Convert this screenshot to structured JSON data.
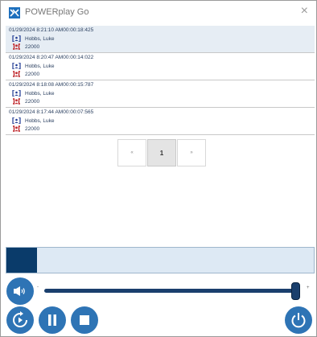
{
  "window": {
    "title": "POWERplay Go",
    "close_glyph": "×",
    "icon": "powerplay-app-icon"
  },
  "recordings": [
    {
      "datetime": "01/29/2024 8:21:10 AM",
      "duration": "00:00:18:425",
      "caller": "Hobbs, Luke",
      "callee": "22000",
      "selected": true
    },
    {
      "datetime": "01/29/2024 8:20:47 AM",
      "duration": "00:00:14:022",
      "caller": "Hobbs, Luke",
      "callee": "22000",
      "selected": false
    },
    {
      "datetime": "01/29/2024 8:18:08 AM",
      "duration": "00:00:15:787",
      "caller": "Hobbs, Luke",
      "callee": "22000",
      "selected": false
    },
    {
      "datetime": "01/29/2024 8:17:44 AM",
      "duration": "00:00:07:565",
      "caller": "Hobbs, Luke",
      "callee": "22000",
      "selected": false
    }
  ],
  "pagination": {
    "prev_label": "«",
    "current_page": "1",
    "next_label": "»"
  },
  "playback": {
    "progress_fraction": 0.1
  },
  "volume": {
    "min_label": "-",
    "max_label": "+",
    "level_fraction": 1.0
  },
  "icons": {
    "volume": "speaker-icon",
    "replay": "replay-icon",
    "pause": "pause-icon",
    "stop": "stop-icon",
    "power": "power-icon",
    "caller": "caller-icon",
    "callee": "callee-icon"
  },
  "colors": {
    "accent": "#2e74b5",
    "dark_accent": "#0a3b6a",
    "caller_icon": "#1f3a93",
    "callee_icon": "#c0282d",
    "row_selected": "#e6edf4"
  }
}
